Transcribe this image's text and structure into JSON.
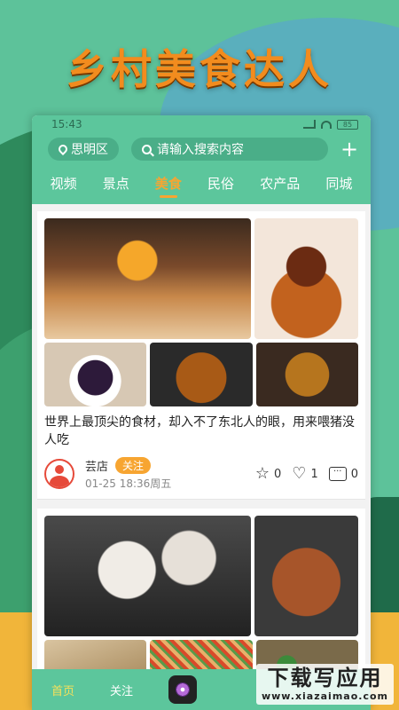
{
  "headline": "乡村美食达人",
  "status_bar": {
    "time": "15:43",
    "battery": "85"
  },
  "header": {
    "location": "思明区",
    "search_placeholder": "请输入搜索内容",
    "add_icon": "plus-icon"
  },
  "tabs": [
    {
      "label": "视频",
      "active": false
    },
    {
      "label": "景点",
      "active": false
    },
    {
      "label": "美食",
      "active": true
    },
    {
      "label": "民俗",
      "active": false
    },
    {
      "label": "农产品",
      "active": false
    },
    {
      "label": "同城",
      "active": false
    }
  ],
  "posts": [
    {
      "title": "世界上最顶尖的食材，却入不了东北人的眼，用来喂猪没人吃",
      "author": "芸店",
      "follow_label": "关注",
      "date": "01-25",
      "time": "18:36周五",
      "stars": "0",
      "likes": "1",
      "comments": "0"
    }
  ],
  "bottom_nav": {
    "home": "首页",
    "follow": "关注"
  },
  "watermark": {
    "title": "下载写应用",
    "url": "www.xiazaimao.com"
  },
  "colors": {
    "primary": "#5cc69c",
    "accent": "#f7a531",
    "headline": "#f28c1e"
  }
}
